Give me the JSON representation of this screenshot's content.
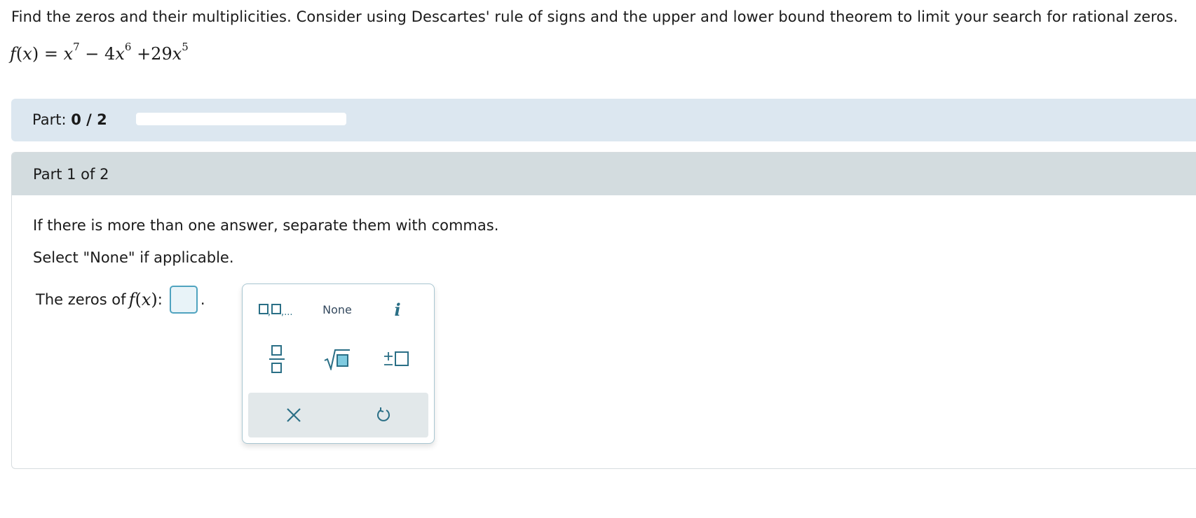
{
  "problem": {
    "instructions": "Find the zeros and their multiplicities. Consider using Descartes' rule of signs and the upper and lower bound theorem to limit your search for rational zeros.",
    "function_lhs_name": "f",
    "function_lhs_var": "x",
    "terms": {
      "t1_base": "x",
      "t1_exp": "7",
      "t2_op": "−",
      "t2_coef": "4",
      "t2_base": "x",
      "t2_exp": "6",
      "t3_op": "+",
      "t3_coef": "29",
      "t3_base": "x",
      "t3_exp": "5"
    }
  },
  "progress": {
    "label": "Part:",
    "value_text": "0 / 2",
    "fraction": 0
  },
  "part": {
    "title": "Part 1 of 2",
    "instruction_1": "If there is more than one answer, separate them with commas.",
    "instruction_2": "Select \"None\" if applicable.",
    "answer_label": "The zeros of",
    "answer_fx_name": "f",
    "answer_fx_var": "x",
    "answer_value": ""
  },
  "keypad": {
    "list_key": "list-template",
    "none_label": "None",
    "info_label": "i",
    "fraction_key": "fraction-template",
    "sqrt_key": "sqrt-template",
    "plusminus_key": "plus-minus-template",
    "clear_key": "clear-icon",
    "undo_key": "undo-icon"
  },
  "colors": {
    "accent": "#2a6f86",
    "answer_border": "#4fa3bf",
    "progress_bg": "#dce7f0",
    "part_header_bg": "#d3dcdf"
  }
}
